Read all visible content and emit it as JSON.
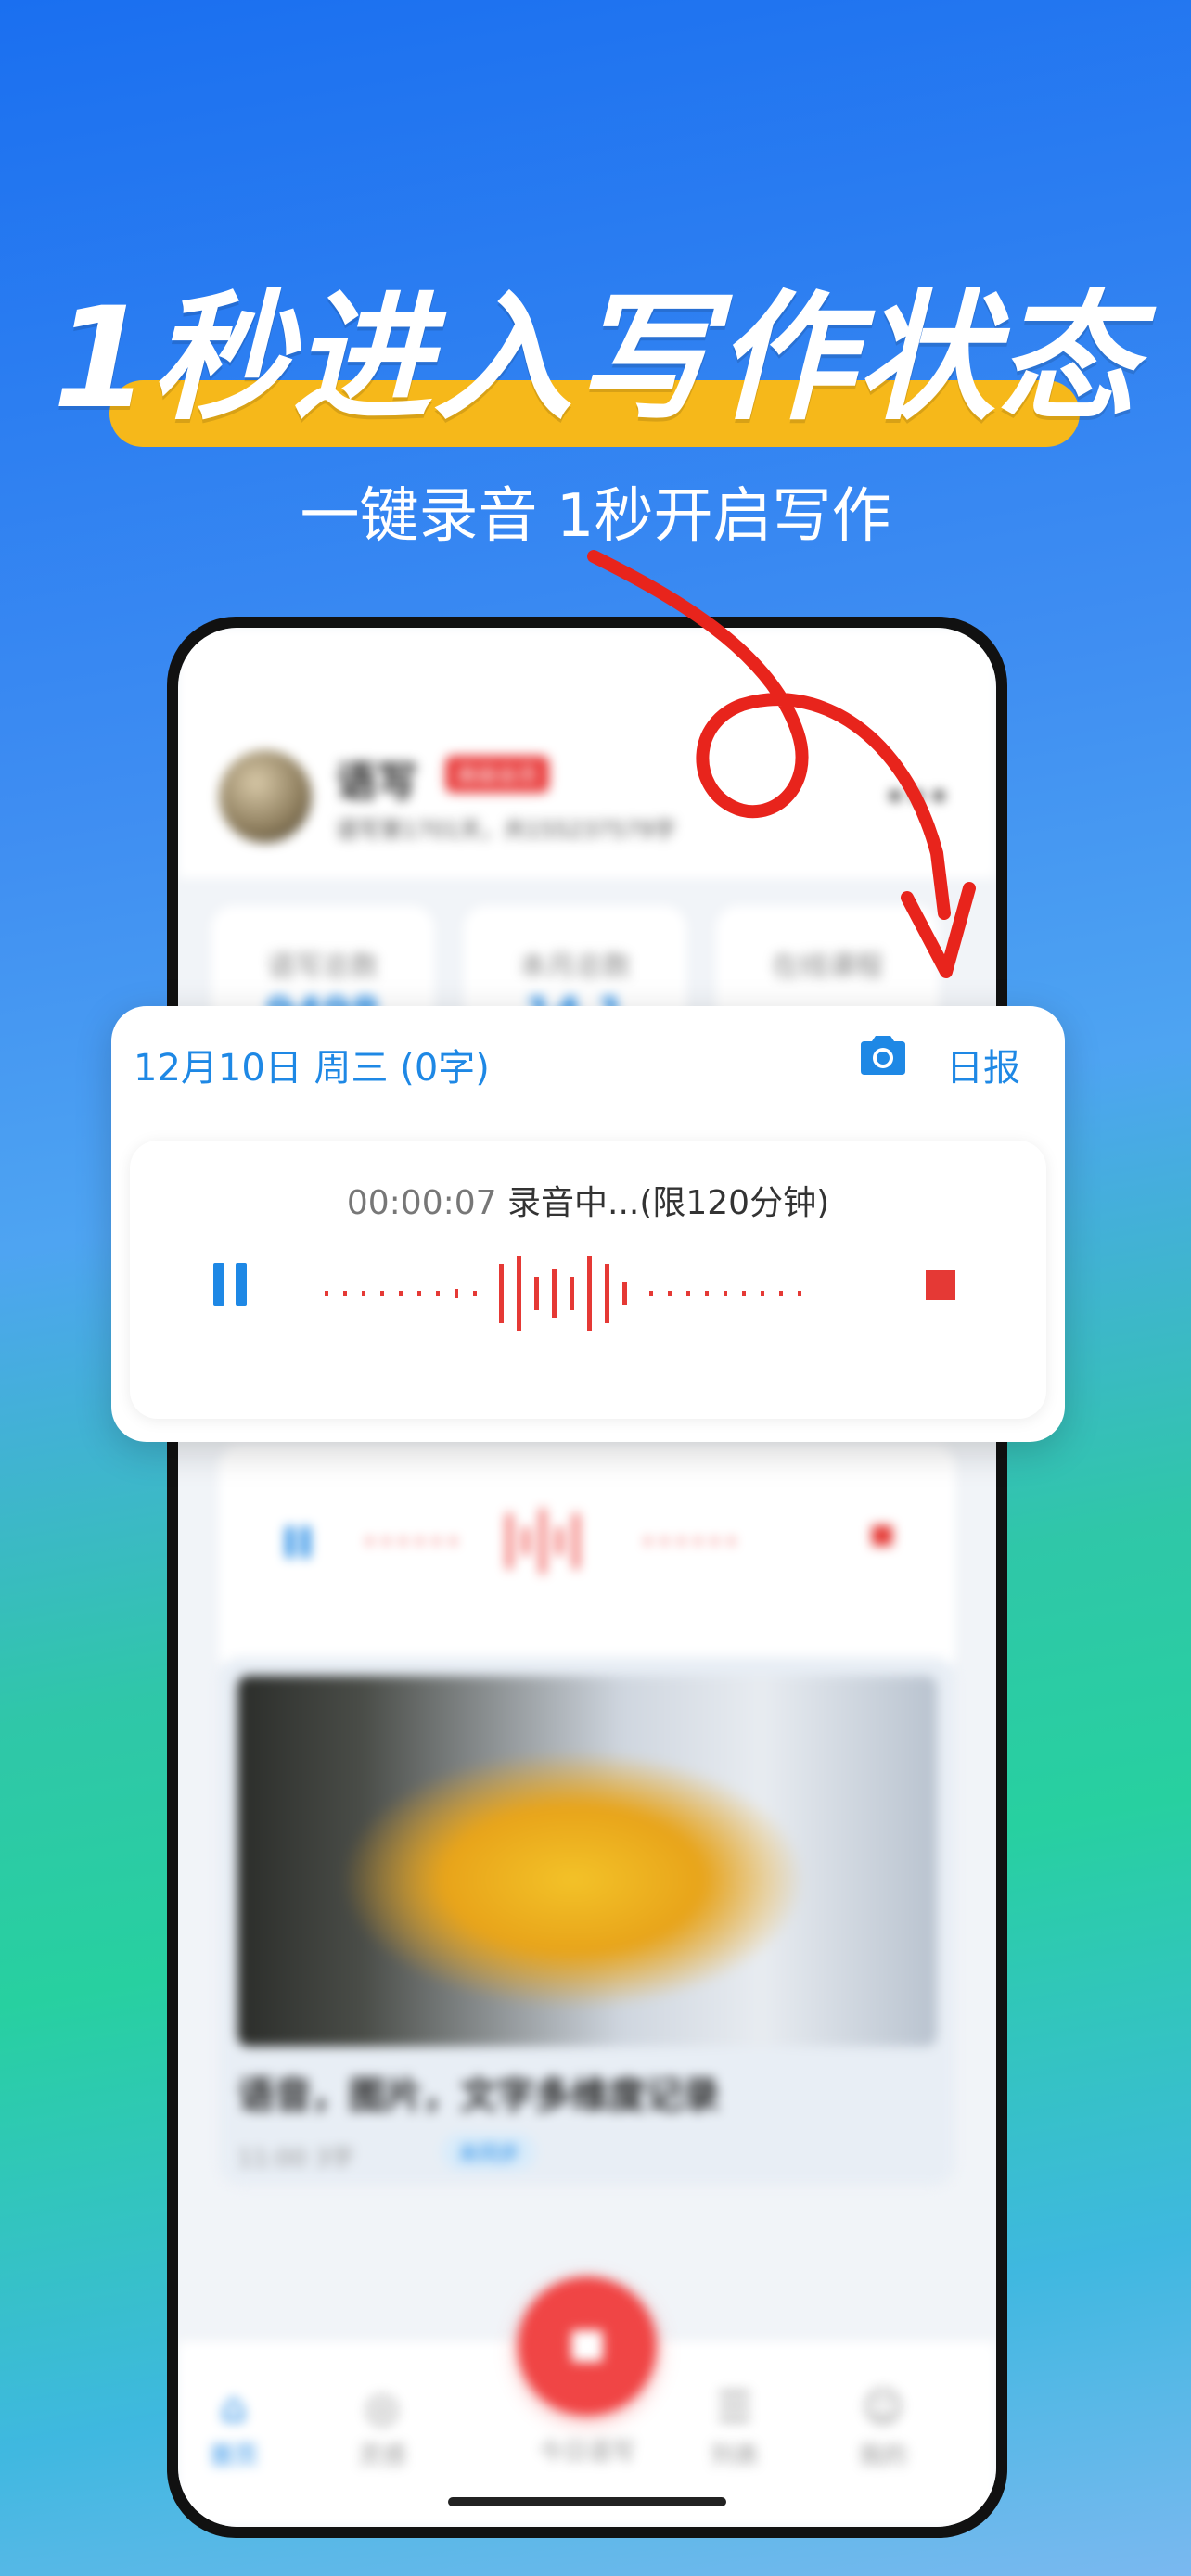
{
  "promo": {
    "headline": "1秒进入写作状态",
    "subheadline": "一键录音 1秒开启写作"
  },
  "app": {
    "name": "语写",
    "vip_badge": "高级会员",
    "user_desc": "语写第1701天，共155237579字",
    "stats": [
      {
        "label": "语写总数",
        "value": "9498"
      },
      {
        "label": "本月总数",
        "value": "14.1"
      },
      {
        "label": "在线课程",
        "value": ""
      }
    ],
    "photo_card": {
      "caption": "语音，图片，文字多维度记录",
      "time": "11:00",
      "words": "3字",
      "sync": "未同步"
    },
    "tabs": [
      {
        "label": "首页",
        "icon": "home-icon"
      },
      {
        "label": "灵感",
        "icon": "bulb-icon"
      },
      {
        "label": "今日语写",
        "icon": "record-icon"
      },
      {
        "label": "列表",
        "icon": "list-icon"
      },
      {
        "label": "我的",
        "icon": "user-icon"
      }
    ]
  },
  "recording": {
    "date": "12月10日 周三 (0字)",
    "report": "日报",
    "time": "00:00:07",
    "status": "录音中...(限120分钟)"
  },
  "colors": {
    "accent": "#1e88e5",
    "record_red": "#e53935",
    "highlight": "#f6b81a"
  }
}
